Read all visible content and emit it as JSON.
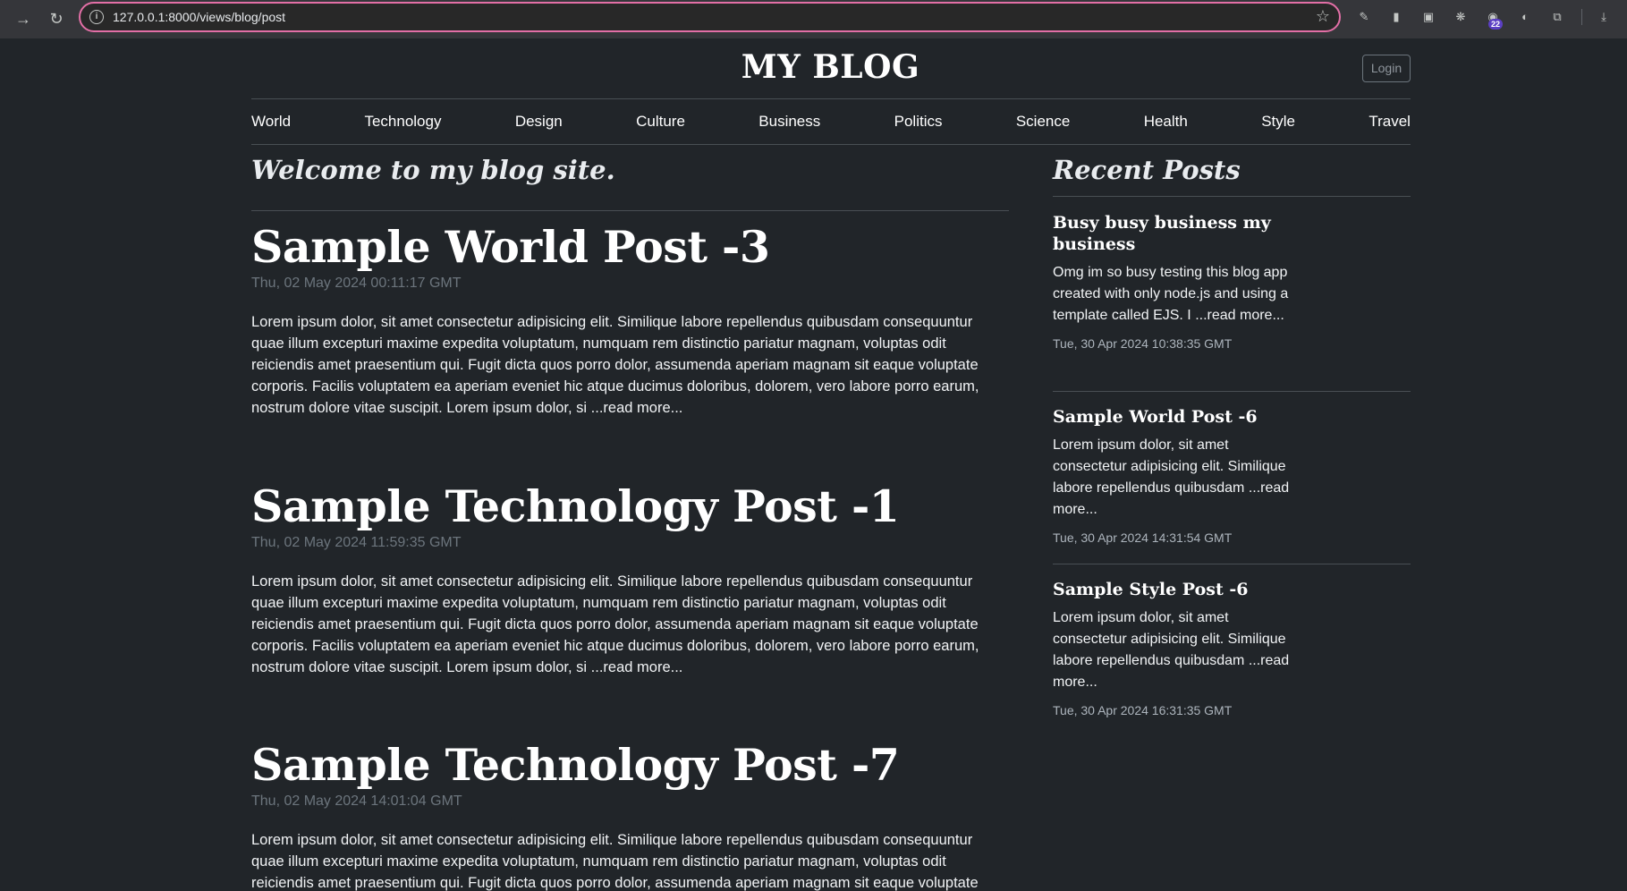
{
  "browser": {
    "url": "127.0.0.1:8000/views/blog/post",
    "back_icon": "arrow-right-icon",
    "reload_icon": "reload-icon",
    "extension_badge": "22"
  },
  "header": {
    "title": "MY BLOG",
    "login_label": "Login"
  },
  "nav": {
    "items": [
      "World",
      "Technology",
      "Design",
      "Culture",
      "Business",
      "Politics",
      "Science",
      "Health",
      "Style",
      "Travel"
    ]
  },
  "main": {
    "welcome": "Welcome to my blog site.",
    "posts": [
      {
        "title": "Sample World Post -3",
        "date": "Thu, 02 May 2024 00:11:17 GMT",
        "body": "Lorem ipsum dolor, sit amet consectetur adipisicing elit. Similique labore repellendus quibusdam consequuntur quae illum excepturi maxime expedita voluptatum, numquam rem distinctio pariatur magnam, voluptas odit reiciendis amet praesentium qui. Fugit dicta quos porro dolor, assumenda aperiam magnam sit eaque voluptate corporis. Facilis voluptatem ea aperiam eveniet hic atque ducimus doloribus, dolorem, vero labore porro earum, nostrum dolore vitae suscipit. Lorem ipsum dolor, si ...read more..."
      },
      {
        "title": "Sample Technology Post -1",
        "date": "Thu, 02 May 2024 11:59:35 GMT",
        "body": "Lorem ipsum dolor, sit amet consectetur adipisicing elit. Similique labore repellendus quibusdam consequuntur quae illum excepturi maxime expedita voluptatum, numquam rem distinctio pariatur magnam, voluptas odit reiciendis amet praesentium qui. Fugit dicta quos porro dolor, assumenda aperiam magnam sit eaque voluptate corporis. Facilis voluptatem ea aperiam eveniet hic atque ducimus doloribus, dolorem, vero labore porro earum, nostrum dolore vitae suscipit. Lorem ipsum dolor, si ...read more..."
      },
      {
        "title": "Sample Technology Post -7",
        "date": "Thu, 02 May 2024 14:01:04 GMT",
        "body": "Lorem ipsum dolor, sit amet consectetur adipisicing elit. Similique labore repellendus quibusdam consequuntur quae illum excepturi maxime expedita voluptatum, numquam rem distinctio pariatur magnam, voluptas odit reiciendis amet praesentium qui. Fugit dicta quos porro dolor, assumenda aperiam magnam sit eaque voluptate corporis. Facilis"
      }
    ]
  },
  "sidebar": {
    "title": "Recent Posts",
    "posts": [
      {
        "title": "Busy busy business my business",
        "excerpt": "Omg im so busy testing this blog app created with only node.js and using a template called EJS. I ...read more...",
        "date": "Tue, 30 Apr 2024 10:38:35 GMT"
      },
      {
        "title": "Sample World Post -6",
        "excerpt": "Lorem ipsum dolor, sit amet consectetur adipisicing elit. Similique labore repellendus quibusdam ...read more...",
        "date": "Tue, 30 Apr 2024 14:31:54 GMT"
      },
      {
        "title": "Sample Style Post -6",
        "excerpt": "Lorem ipsum dolor, sit amet consectetur adipisicing elit. Similique labore repellendus quibusdam ...read more...",
        "date": "Tue, 30 Apr 2024 16:31:35 GMT"
      }
    ]
  },
  "colors": {
    "page_background": "#212529",
    "omnibox_border": "#e36fa6",
    "muted_text": "#6c757d"
  }
}
